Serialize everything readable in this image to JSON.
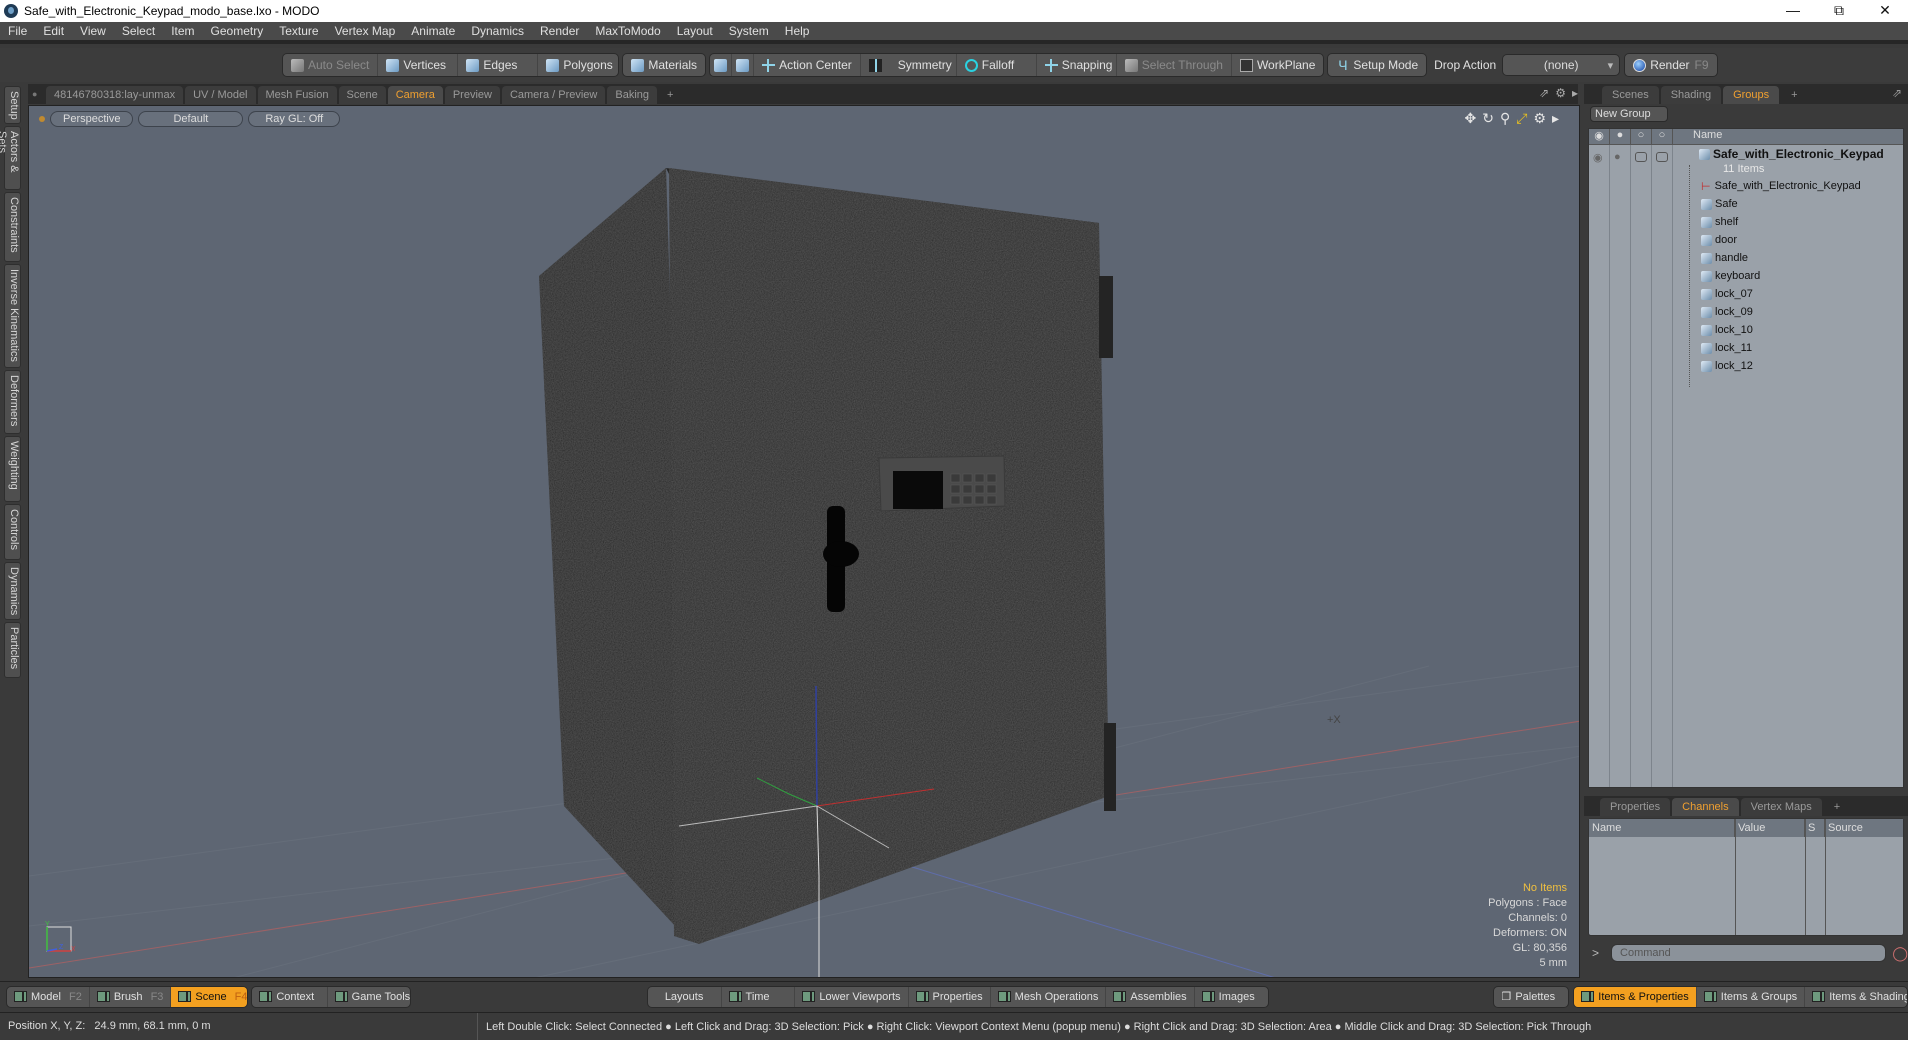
{
  "window": {
    "title": "Safe_with_Electronic_Keypad_modo_base.lxo - MODO",
    "controls": [
      "minimize-icon",
      "restore-icon",
      "close-icon"
    ]
  },
  "menu": [
    "File",
    "Edit",
    "View",
    "Select",
    "Item",
    "Geometry",
    "Texture",
    "Vertex Map",
    "Animate",
    "Dynamics",
    "Render",
    "MaxToModo",
    "Layout",
    "System",
    "Help"
  ],
  "toolbar": {
    "auto_select": "Auto Select",
    "vertices": "Vertices",
    "edges": "Edges",
    "polygons": "Polygons",
    "materials": "Materials",
    "action_center": "Action Center",
    "symmetry": "Symmetry",
    "falloff": "Falloff",
    "snapping": "Snapping",
    "select_through": "Select Through",
    "workplane": "WorkPlane",
    "setup_mode": "Setup Mode",
    "drop_action_label": "Drop Action",
    "drop_action_value": "(none)",
    "render": "Render",
    "render_key": "F9"
  },
  "left_tabs": [
    "Setup",
    "Actors & Sets",
    "Constraints",
    "Inverse Kinematics",
    "Deformers",
    "Weighting",
    "Controls",
    "Dynamics",
    "Particles"
  ],
  "viewport_tabs": {
    "items": [
      "48146780318:lay-unmax",
      "UV / Model",
      "Mesh Fusion",
      "Scene",
      "Camera",
      "Preview",
      "Camera / Preview",
      "Baking"
    ],
    "active": "Camera",
    "add": "+"
  },
  "viewport": {
    "view_mode": "Perspective",
    "shading": "Default",
    "raygl": "Ray GL: Off",
    "info": {
      "selection": "No Items",
      "polygons": "Polygons : Face",
      "channels": "Channels: 0",
      "deformers": "Deformers: ON",
      "gl": "GL: 80,356",
      "grid": "5 mm"
    },
    "axis_labels": {
      "x": "X",
      "y": "Y",
      "z": "Z"
    },
    "cursor_label": "+X"
  },
  "right_top_tabs": {
    "items": [
      "Scenes",
      "Shading",
      "Groups"
    ],
    "active": "Groups",
    "add": "+"
  },
  "groups": {
    "new_group": "New Group",
    "column_name": "Name",
    "root": {
      "name": "Safe_with_Electronic_Keypad",
      "count": "11 Items"
    },
    "items": [
      {
        "name": "Safe_with_Electronic_Keypad",
        "icon": "locator-icon"
      },
      {
        "name": "Safe",
        "icon": "mesh-icon"
      },
      {
        "name": "shelf",
        "icon": "mesh-icon"
      },
      {
        "name": "door",
        "icon": "mesh-icon"
      },
      {
        "name": "handle",
        "icon": "mesh-icon"
      },
      {
        "name": "keyboard",
        "icon": "mesh-icon"
      },
      {
        "name": "lock_07",
        "icon": "mesh-icon"
      },
      {
        "name": "lock_09",
        "icon": "mesh-icon"
      },
      {
        "name": "lock_10",
        "icon": "mesh-icon"
      },
      {
        "name": "lock_11",
        "icon": "mesh-icon"
      },
      {
        "name": "lock_12",
        "icon": "mesh-icon"
      }
    ]
  },
  "right_bottom_tabs": {
    "items": [
      "Properties",
      "Channels",
      "Vertex Maps"
    ],
    "active": "Channels",
    "add": "+"
  },
  "channels": {
    "columns": [
      "Name",
      "Value",
      "S",
      "Source"
    ]
  },
  "command": {
    "prompt": ">",
    "placeholder": "Command"
  },
  "bottom_bar": {
    "left": [
      {
        "label": "Model",
        "key": "F2"
      },
      {
        "label": "Brush",
        "key": "F3"
      },
      {
        "label": "Scene",
        "key": "F4",
        "active": true
      },
      {
        "label": "Context"
      },
      {
        "label": "Game Tools"
      }
    ],
    "center": [
      "Layouts",
      "Time",
      "Lower Viewports",
      "Properties",
      "Mesh Operations",
      "Assemblies",
      "Images"
    ],
    "palettes": "Palettes",
    "right": [
      {
        "label": "Items & Properties",
        "active": true
      },
      {
        "label": "Items & Groups"
      },
      {
        "label": "Items & Shading"
      }
    ]
  },
  "status": {
    "position_label": "Position X, Y, Z:",
    "position_value": "24.9 mm, 68.1 mm, 0 m",
    "hints": "Left Double Click: Select Connected ● Left Click and Drag: 3D Selection: Pick ● Right Click: Viewport Context Menu (popup menu) ● Right Click and Drag: 3D Selection: Area ● Middle Click and Drag: 3D Selection: Pick Through"
  },
  "colors": {
    "accent": "#f0a030",
    "viewport_bg": "#5e6673",
    "active_button": "#f3a020"
  }
}
